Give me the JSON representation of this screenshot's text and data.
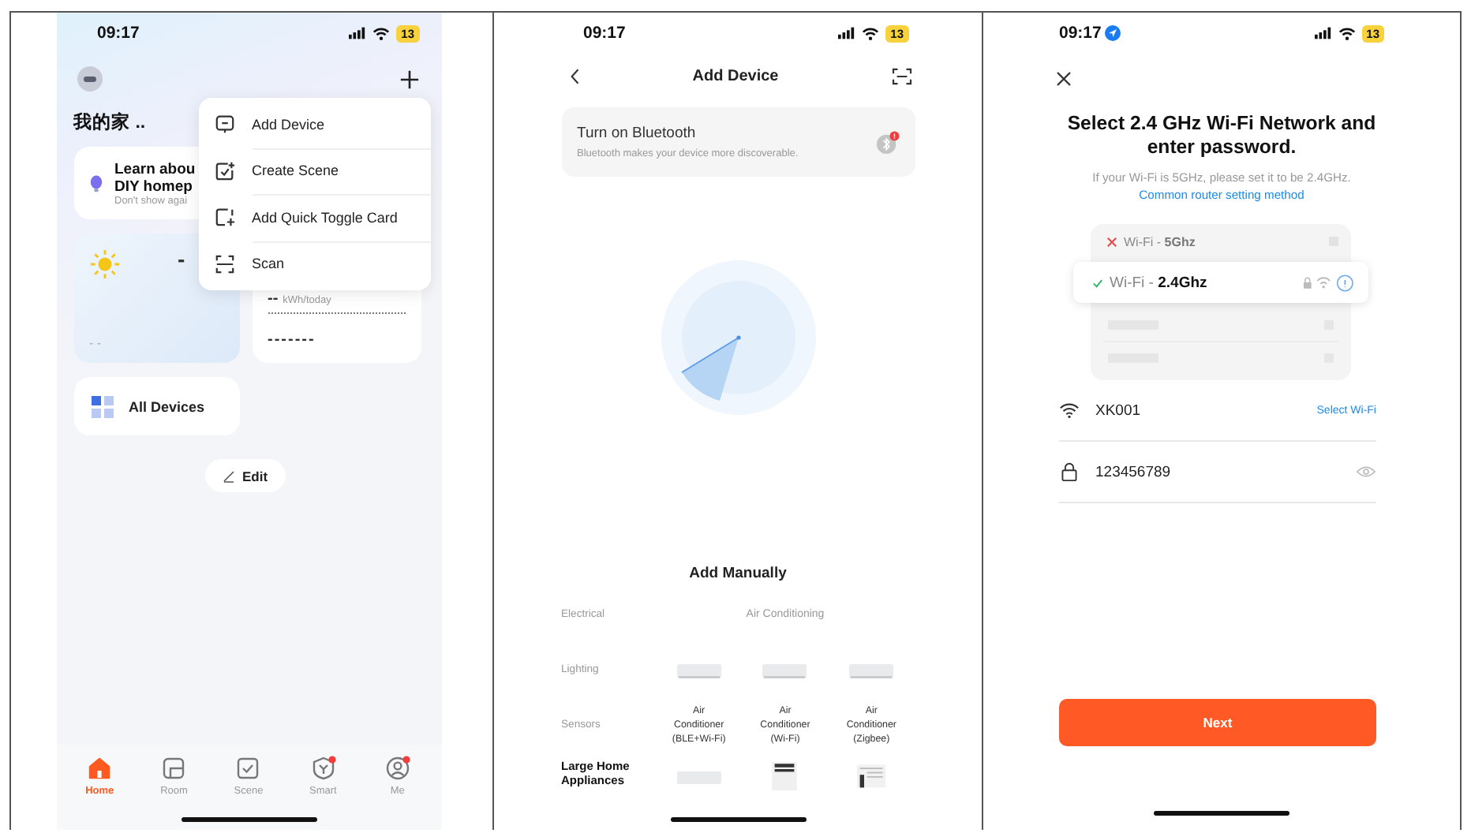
{
  "home_screen": {
    "status_bar": {
      "time": "09:17",
      "battery": "13",
      "location": false
    },
    "home_name": "我的家 ..",
    "tip_card": {
      "title_lines": [
        "Learn abou",
        "DIY homep"
      ],
      "subtitle": "Don't show agai"
    },
    "weather_card": {
      "value": "-",
      "footer": "- -"
    },
    "energy_card": {
      "value": "--",
      "unit": "kWh/today",
      "footer": "-------"
    },
    "all_devices": "All Devices",
    "edit": "Edit",
    "menu": [
      {
        "kind": "device",
        "label": "Add Device"
      },
      {
        "kind": "scene",
        "label": "Create Scene"
      },
      {
        "kind": "toggle",
        "label": "Add Quick Toggle Card"
      },
      {
        "kind": "scan",
        "label": "Scan"
      }
    ],
    "tabs": [
      {
        "kind": "home",
        "label": "Home",
        "selected": true,
        "badge": false
      },
      {
        "kind": "room",
        "label": "Room",
        "selected": false,
        "badge": false
      },
      {
        "kind": "scene",
        "label": "Scene",
        "selected": false,
        "badge": false
      },
      {
        "kind": "smart",
        "label": "Smart",
        "selected": false,
        "badge": true
      },
      {
        "kind": "me",
        "label": "Me",
        "selected": false,
        "badge": true
      }
    ]
  },
  "add_device_screen": {
    "status_bar": {
      "time": "09:17",
      "battery": "13",
      "location": false
    },
    "title": "Add Device",
    "bluetooth": {
      "title": "Turn on Bluetooth",
      "text": "Bluetooth makes your device more discoverable."
    },
    "section": "Add Manually",
    "categories": [
      {
        "label": "Electrical",
        "selected": false
      },
      {
        "label": "Lighting",
        "selected": false
      },
      {
        "label": "Sensors",
        "selected": false
      },
      {
        "label": "Large Home Appliances",
        "selected": true
      }
    ],
    "group": "Air Conditioning",
    "products": [
      {
        "name": "Air Conditioner (BLE+Wi-Fi)"
      },
      {
        "name": "Air Conditioner (Wi-Fi)"
      },
      {
        "name": "Air Conditioner (Zigbee)"
      }
    ]
  },
  "wifi_screen": {
    "status_bar": {
      "time": "09:17",
      "battery": "13",
      "location": true
    },
    "title": "Select 2.4 GHz Wi-Fi Network and enter password.",
    "hint": "If your Wi-Fi is 5GHz, please set it to be 2.4GHz.",
    "link": "Common router setting method",
    "networks": [
      {
        "label": "Wi-Fi - **5Ghz**",
        "supported": false
      },
      {
        "label": "Wi-Fi - **2.4Ghz**",
        "supported": true
      }
    ],
    "ssid": "XK001",
    "select": "Select Wi-Fi",
    "password": "123456789",
    "next": "Next"
  }
}
